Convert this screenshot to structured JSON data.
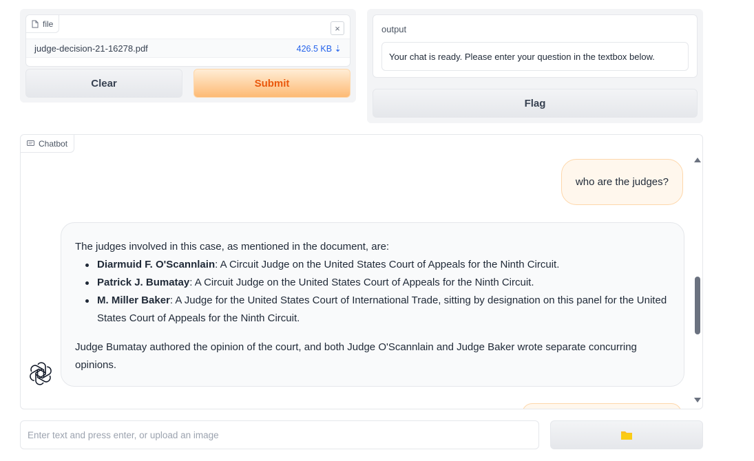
{
  "file_component": {
    "label": "file",
    "file_name": "judge-decision-21-16278.pdf",
    "file_size": "426.5 KB ⇣",
    "close_symbol": "×"
  },
  "actions": {
    "clear_label": "Clear",
    "submit_label": "Submit",
    "flag_label": "Flag"
  },
  "output": {
    "label": "output",
    "value": "Your chat is ready. Please enter your question in the textbox below."
  },
  "chatbot": {
    "label": "Chatbot",
    "user_message": "who are the judges?",
    "bot_intro": "The judges involved in this case, as mentioned in the document, are:",
    "judges": [
      {
        "name": "Diarmuid F. O'Scannlain",
        "desc": ": A Circuit Judge on the United States Court of Appeals for the Ninth Circuit."
      },
      {
        "name": "Patrick J. Bumatay",
        "desc": ": A Circuit Judge on the United States Court of Appeals for the Ninth Circuit."
      },
      {
        "name": "M. Miller Baker",
        "desc": ": A Judge for the United States Court of International Trade, sitting by designation on this panel for the United States Court of Appeals for the Ninth Circuit."
      }
    ],
    "bot_outro": "Judge Bumatay authored the opinion of the court, and both Judge O'Scannlain and Judge Baker wrote separate concurring opinions."
  },
  "input": {
    "placeholder": "Enter text and press enter, or upload an image"
  },
  "icons": {
    "file": "file-icon",
    "chat": "chat-icon",
    "avatar": "openai-logo-icon",
    "upload": "folder-icon"
  },
  "colors": {
    "accent": "#ea580c",
    "submit_bg": "#fdba74",
    "user_bubble": "#fff7ed",
    "file_size_link": "#2563eb",
    "folder": "#fbbf24"
  }
}
